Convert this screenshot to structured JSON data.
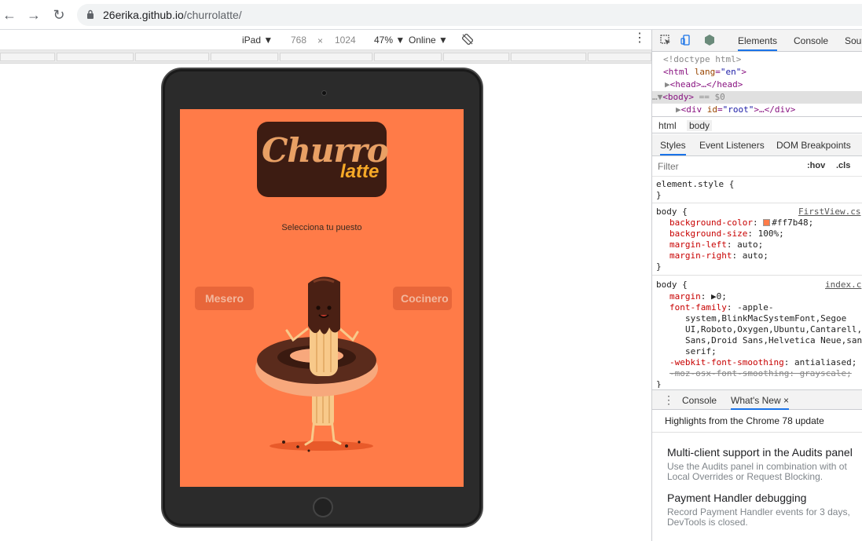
{
  "browser": {
    "url_host": "26erika.github.io",
    "url_path": "/churrolatte/"
  },
  "device_toolbar": {
    "device": "iPad ▼",
    "width": "768",
    "times": "×",
    "height": "1024",
    "zoom": "47% ▼",
    "network": "Online ▼"
  },
  "app": {
    "logo_word1": "Churro",
    "logo_word2": "latte",
    "prompt": "Selecciona tu puesto",
    "button_left": "Mesero",
    "button_right": "Cocinero",
    "background_color": "#ff7b48"
  },
  "devtools": {
    "tabs": [
      "Elements",
      "Console",
      "Sou"
    ],
    "tree": {
      "doctype": "<!doctype html>",
      "html_tag": "<html",
      "html_attr": "lang",
      "html_val": "\"en\"",
      "html_close": ">",
      "head": "<head>…</head>",
      "body": "<body>",
      "body_marker": "== $0",
      "div_open": "<div",
      "div_attr": "id",
      "div_val": "\"root\"",
      "div_rest": ">…</div>"
    },
    "breadcrumbs": [
      "html",
      "body"
    ],
    "subtabs": [
      "Styles",
      "Event Listeners",
      "DOM Breakpoints"
    ],
    "filter_placeholder": "Filter",
    "hov": ":hov",
    "cls": ".cls",
    "element_style": "element.style {",
    "brace_close": "}",
    "rule1_selector": "body {",
    "rule1_source": "FirstView.cs",
    "rule1_props": [
      {
        "name": "background-color",
        "value": "#ff7b48;"
      },
      {
        "name": "background-size",
        "value": "100%;"
      },
      {
        "name": "margin-left",
        "value": "auto;"
      },
      {
        "name": "margin-right",
        "value": "auto;"
      }
    ],
    "rule2_selector": "body {",
    "rule2_source": "index.c",
    "rule2_margin_name": "margin",
    "rule2_margin_value": "0;",
    "rule2_font_name": "font-family",
    "rule2_font_lines": [
      " -apple-",
      "system,BlinkMacSystemFont,Segoe",
      "UI,Roboto,Oxygen,Ubuntu,Cantarell,",
      "Sans,Droid Sans,Helvetica Neue,san",
      "serif;"
    ],
    "rule2_smooth_name": "-webkit-font-smoothing",
    "rule2_smooth_value": "antialiased;",
    "rule2_moz": "-moz-osx-font-smoothing: grayscale;",
    "drawer_tabs": [
      "Console",
      "What's New"
    ],
    "drawer_close": "×",
    "highlights": "Highlights from the Chrome 78 update",
    "news": [
      {
        "title": "Multi-client support in the Audits panel",
        "desc1": "Use the Audits panel in combination with ot",
        "desc2": "Local Overrides or Request Blocking."
      },
      {
        "title": "Payment Handler debugging",
        "desc1": "Record Payment Handler events for 3 days,",
        "desc2": "DevTools is closed."
      }
    ]
  }
}
